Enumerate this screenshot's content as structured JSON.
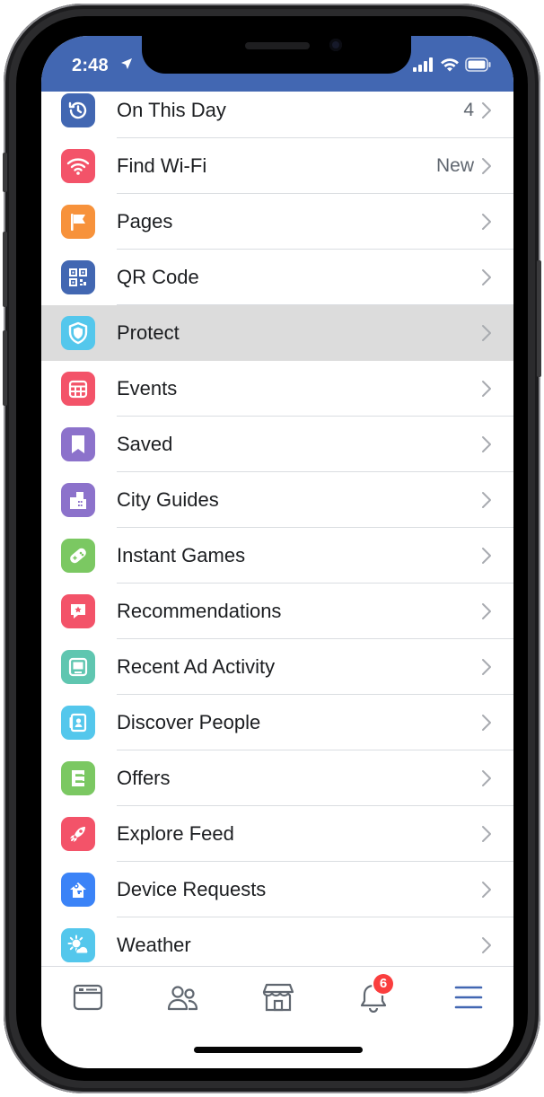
{
  "status_bar": {
    "time": "2:48"
  },
  "menu": {
    "items": [
      {
        "label": "On This Day",
        "meta": "4",
        "icon": "history-icon",
        "color": "#4267b2"
      },
      {
        "label": "Find Wi-Fi",
        "meta": "New",
        "icon": "wifi-icon",
        "color": "#f35369"
      },
      {
        "label": "Pages",
        "meta": "",
        "icon": "flag-icon",
        "color": "#f7923b"
      },
      {
        "label": "QR Code",
        "meta": "",
        "icon": "qr-code-icon",
        "color": "#4267b2"
      },
      {
        "label": "Protect",
        "meta": "",
        "icon": "shield-icon",
        "color": "#54c7ec"
      },
      {
        "label": "Events",
        "meta": "",
        "icon": "calendar-icon",
        "color": "#f35369"
      },
      {
        "label": "Saved",
        "meta": "",
        "icon": "bookmark-icon",
        "color": "#8c72cb"
      },
      {
        "label": "City Guides",
        "meta": "",
        "icon": "city-icon",
        "color": "#8c72cb"
      },
      {
        "label": "Instant Games",
        "meta": "",
        "icon": "gamepad-icon",
        "color": "#7bc862"
      },
      {
        "label": "Recommendations",
        "meta": "",
        "icon": "recommend-icon",
        "color": "#f35369"
      },
      {
        "label": "Recent Ad Activity",
        "meta": "",
        "icon": "monitor-icon",
        "color": "#5fc6b0"
      },
      {
        "label": "Discover People",
        "meta": "",
        "icon": "contact-card-icon",
        "color": "#54c7ec"
      },
      {
        "label": "Offers",
        "meta": "",
        "icon": "offer-icon",
        "color": "#7bc862"
      },
      {
        "label": "Explore Feed",
        "meta": "",
        "icon": "rocket-icon",
        "color": "#f35369"
      },
      {
        "label": "Device Requests",
        "meta": "",
        "icon": "device-key-icon",
        "color": "#3b83f7"
      },
      {
        "label": "Weather",
        "meta": "",
        "icon": "weather-icon",
        "color": "#54c7ec"
      }
    ],
    "highlighted_index": 4
  },
  "tabbar": {
    "notifications_badge": "6",
    "active_color": "#4267b2",
    "inactive_color": "#606770"
  },
  "colors": {
    "brand": "#4267b2",
    "badge": "#fa3e3e"
  }
}
